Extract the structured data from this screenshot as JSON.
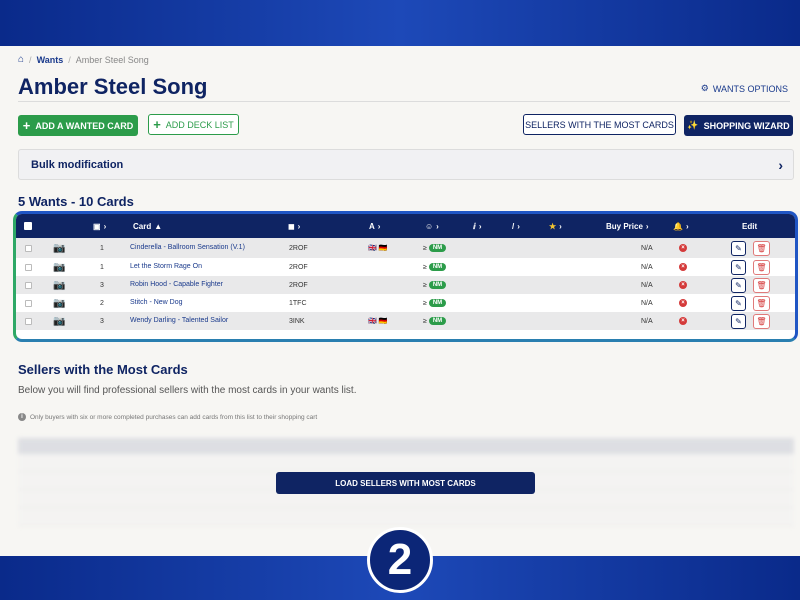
{
  "breadcrumb": {
    "home_icon": "home-icon",
    "wants": "Wants",
    "current": "Amber Steel Song"
  },
  "page": {
    "title": "Amber Steel Song",
    "wants_options": "WANTS OPTIONS"
  },
  "buttons": {
    "add_wanted_card": "ADD A WANTED CARD",
    "add_deck_list": "ADD DECK LIST",
    "sellers_most_cards": "SELLERS WITH THE MOST CARDS",
    "shopping_wizard": "SHOPPING WIZARD",
    "load_sellers": "LOAD SELLERS WITH MOST CARDS"
  },
  "bulk": {
    "label": "Bulk modification"
  },
  "wants_summary": "5 Wants - 10 Cards",
  "table": {
    "headers": {
      "card": "Card",
      "buy_price": "Buy Price",
      "edit": "Edit"
    },
    "rows": [
      {
        "qty": "1",
        "name": "Cinderella - Ballroom Sensation (V.1)",
        "set": "2ROF",
        "flags": "🇬🇧 🇩🇪",
        "condition": "NM",
        "price": "N/A"
      },
      {
        "qty": "1",
        "name": "Let the Storm Rage On",
        "set": "2ROF",
        "flags": "",
        "condition": "NM",
        "price": "N/A"
      },
      {
        "qty": "3",
        "name": "Robin Hood - Capable Fighter",
        "set": "2ROF",
        "flags": "",
        "condition": "NM",
        "price": "N/A"
      },
      {
        "qty": "2",
        "name": "Stitch - New Dog",
        "set": "1TFC",
        "flags": "",
        "condition": "NM",
        "price": "N/A"
      },
      {
        "qty": "3",
        "name": "Wendy Darling - Talented Sailor",
        "set": "3INK",
        "flags": "🇬🇧 🇩🇪",
        "condition": "NM",
        "price": "N/A"
      }
    ]
  },
  "sellers": {
    "title": "Sellers with the Most Cards",
    "description": "Below you will find professional sellers with the most cards in your wants list.",
    "note": "Only buyers with six or more completed purchases can add cards from this list to their shopping cart"
  },
  "step_badge": "2",
  "colors": {
    "navy": "#0f2463",
    "green": "#2c9c4a",
    "red": "#d43a3a"
  }
}
